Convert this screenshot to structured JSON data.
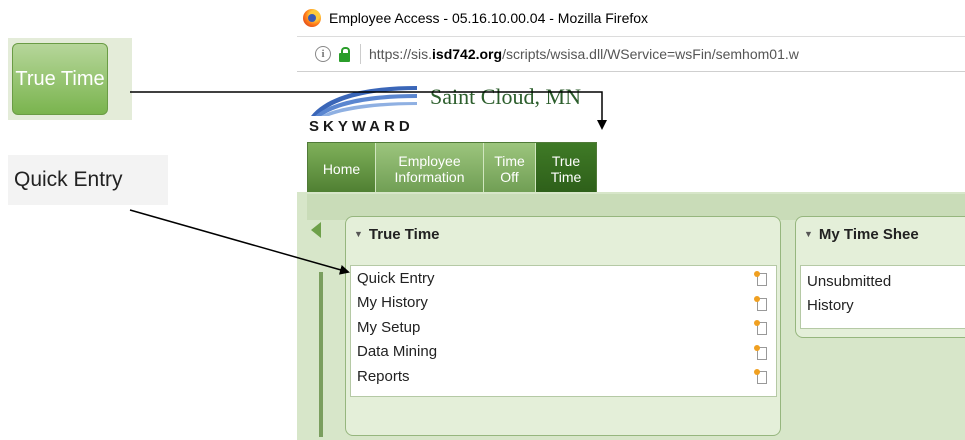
{
  "callouts": {
    "true_time": "True Time",
    "quick_entry": "Quick Entry"
  },
  "browser": {
    "title": "Employee Access - 05.16.10.00.04 - Mozilla Firefox",
    "url_prefix": "https://sis.",
    "url_domain": "isd742.org",
    "url_suffix": "/scripts/wsisa.dll/WService=wsFin/semhom01.w"
  },
  "page": {
    "logo": "SKYWARD",
    "district": "Saint Cloud, MN",
    "nav_tabs": [
      {
        "label": "Home"
      },
      {
        "label": "Employee Information"
      },
      {
        "label": "Time Off"
      },
      {
        "label": "True Time"
      }
    ]
  },
  "panels": {
    "true_time": {
      "title": "True Time",
      "items": [
        {
          "label": "Quick Entry"
        },
        {
          "label": "My History"
        },
        {
          "label": "My Setup"
        },
        {
          "label": "Data Mining"
        },
        {
          "label": "Reports"
        }
      ]
    },
    "time_sheets": {
      "title": "My Time Shee",
      "items": [
        {
          "label": "Unsubmitted"
        },
        {
          "label": "History"
        }
      ]
    }
  }
}
